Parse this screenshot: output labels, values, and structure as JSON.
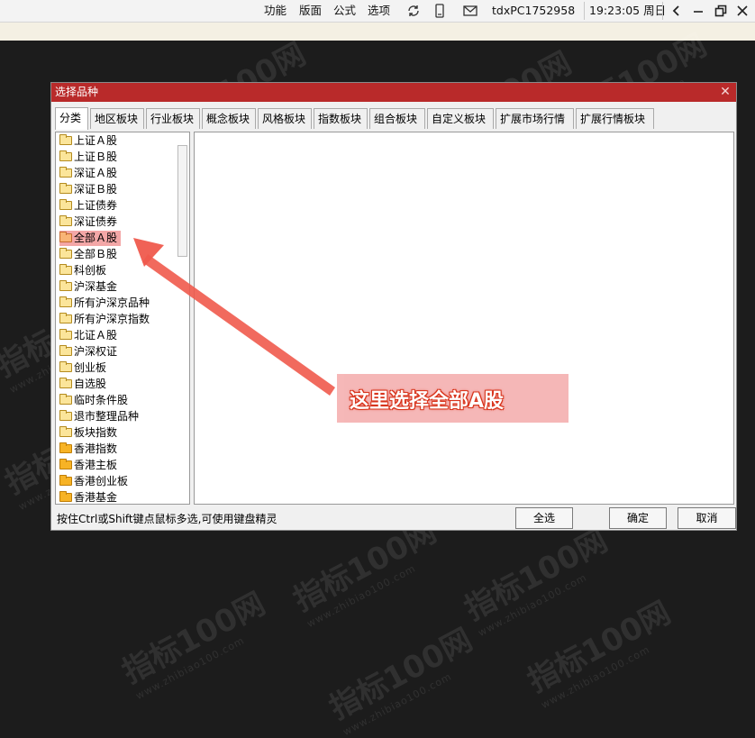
{
  "topbar": {
    "menu": [
      "功能",
      "版面",
      "公式",
      "选项"
    ],
    "machine": "tdxPC1752958",
    "clock": "19:23:05 周日",
    "icons": [
      "refresh-icon",
      "phone-icon",
      "mail-icon",
      "back-icon",
      "minimize-icon",
      "restore-icon",
      "close-icon"
    ]
  },
  "watermark": {
    "text": "指标100网",
    "sub": "www.zhibiao100.com"
  },
  "dialog": {
    "title": "选择品种",
    "close_symbol": "✕",
    "tabs": [
      "分类",
      "地区板块",
      "行业板块",
      "概念板块",
      "风格板块",
      "指数板块",
      "组合板块",
      "自定义板块",
      "扩展市场行情",
      "扩展行情板块"
    ],
    "active_tab": "分类",
    "items": [
      {
        "label": "上证Ａ股",
        "icon": "folder-icon"
      },
      {
        "label": "上证Ｂ股",
        "icon": "folder-icon"
      },
      {
        "label": "深证Ａ股",
        "icon": "folder-icon"
      },
      {
        "label": "深证Ｂ股",
        "icon": "folder-icon"
      },
      {
        "label": "上证债券",
        "icon": "folder-icon"
      },
      {
        "label": "深证债券",
        "icon": "folder-icon"
      },
      {
        "label": "全部Ａ股",
        "icon": "folder-icon",
        "selected": true
      },
      {
        "label": "全部Ｂ股",
        "icon": "folder-icon"
      },
      {
        "label": "科创板",
        "icon": "folder-icon"
      },
      {
        "label": "沪深基金",
        "icon": "folder-icon"
      },
      {
        "label": "所有沪深京品种",
        "icon": "folder-icon"
      },
      {
        "label": "所有沪深京指数",
        "icon": "folder-icon"
      },
      {
        "label": "北证Ａ股",
        "icon": "folder-icon"
      },
      {
        "label": "沪深权证",
        "icon": "folder-icon"
      },
      {
        "label": "创业板",
        "icon": "folder-icon"
      },
      {
        "label": "自选股",
        "icon": "folder-icon"
      },
      {
        "label": "临时条件股",
        "icon": "folder-icon"
      },
      {
        "label": "退市整理品种",
        "icon": "folder-icon"
      },
      {
        "label": "板块指数",
        "icon": "folder-icon"
      },
      {
        "label": "香港指数",
        "icon": "folder-open-icon"
      },
      {
        "label": "香港主板",
        "icon": "folder-open-icon"
      },
      {
        "label": "香港创业板",
        "icon": "folder-open-icon"
      },
      {
        "label": "香港基金",
        "icon": "folder-open-icon"
      }
    ],
    "hint": "按住Ctrl或Shift键点鼠标多选,可使用键盘精灵",
    "buttons": {
      "select_all": "全选",
      "ok": "确定",
      "cancel": "取消"
    }
  },
  "annotation": {
    "text": "这里选择全部A股",
    "color": "#e53a1f"
  }
}
